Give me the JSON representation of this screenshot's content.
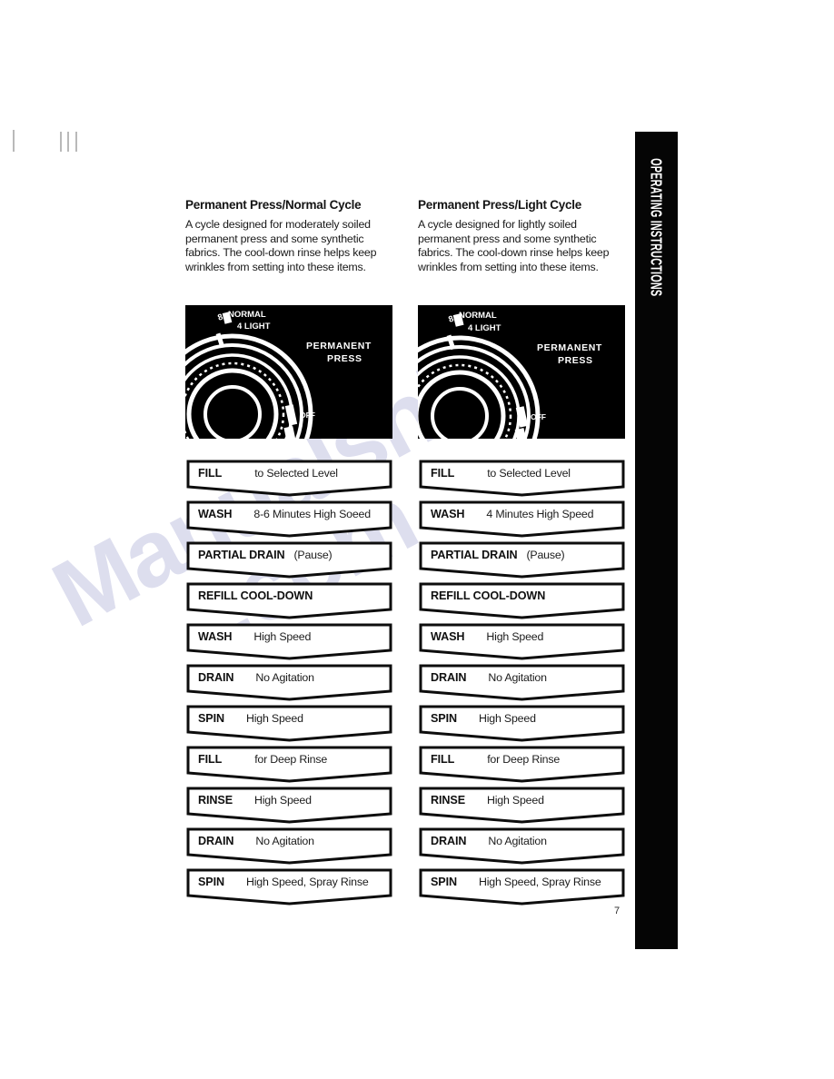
{
  "page": {
    "number": "7",
    "side_tab_label": "OPERATING INSTRUCTIONS",
    "watermark_line1": "Manualshive",
    "watermark_line2": ".com"
  },
  "columns": [
    {
      "id": "permanent-press-normal",
      "title": "Permanent Press/Normal Cycle",
      "description": "A cycle designed for moderately soiled permanent press and some synthetic fabrics. The cool-down rinse helps keep wrinkles from setting into these items.",
      "dial": {
        "label_top_number": "8",
        "label_top": "NORMAL",
        "label_bottom_number": "4",
        "label_bottom": "LIGHT",
        "cycle_name_line1": "PERMANENT",
        "cycle_name_line2": "PRESS",
        "off_label": "OFF"
      },
      "steps": [
        {
          "name": "FILL",
          "detail": "to Selected Level",
          "gap": "gap-wide"
        },
        {
          "name": "WASH",
          "detail": "8-6 Minutes High Soeed",
          "gap": "gap-mid"
        },
        {
          "name": "PARTIAL DRAIN",
          "detail": "(Pause)",
          "gap": "gap-small"
        },
        {
          "name": "REFILL COOL-DOWN",
          "detail": "",
          "gap": "gap-none"
        },
        {
          "name": "WASH",
          "detail": "High Speed",
          "gap": "gap-mid"
        },
        {
          "name": "DRAIN",
          "detail": "No Agitation",
          "gap": "gap-mid"
        },
        {
          "name": "SPIN",
          "detail": "High Speed",
          "gap": "gap-mid"
        },
        {
          "name": "FILL",
          "detail": "for Deep Rinse",
          "gap": "gap-wide"
        },
        {
          "name": "RINSE",
          "detail": "High Speed",
          "gap": "gap-mid"
        },
        {
          "name": "DRAIN",
          "detail": "No Agitation",
          "gap": "gap-mid"
        },
        {
          "name": "SPIN",
          "detail": "High Speed, Spray Rinse",
          "gap": "gap-mid"
        }
      ]
    },
    {
      "id": "permanent-press-light",
      "title": "Permanent Press/Light Cycle",
      "description": "A cycle designed for lightly soiled permanent press and some synthetic fabrics. The cool-down rinse helps keep wrinkles from setting into these items.",
      "dial": {
        "label_top_number": "8",
        "label_top": "NORMAL",
        "label_bottom_number": "4",
        "label_bottom": "LIGHT",
        "cycle_name_line1": "PERMANENT",
        "cycle_name_line2": "PRESS",
        "off_label": "OFF"
      },
      "steps": [
        {
          "name": "FILL",
          "detail": "to Selected Level",
          "gap": "gap-wide"
        },
        {
          "name": "WASH",
          "detail": "4 Minutes High Speed",
          "gap": "gap-mid"
        },
        {
          "name": "PARTIAL DRAIN",
          "detail": "(Pause)",
          "gap": "gap-small"
        },
        {
          "name": "REFILL COOL-DOWN",
          "detail": "",
          "gap": "gap-none"
        },
        {
          "name": "WASH",
          "detail": "High Speed",
          "gap": "gap-mid"
        },
        {
          "name": "DRAIN",
          "detail": "No Agitation",
          "gap": "gap-mid"
        },
        {
          "name": "SPIN",
          "detail": "High Speed",
          "gap": "gap-mid"
        },
        {
          "name": "FILL",
          "detail": "for Deep Rinse",
          "gap": "gap-wide"
        },
        {
          "name": "RINSE",
          "detail": "High Speed",
          "gap": "gap-mid"
        },
        {
          "name": "DRAIN",
          "detail": "No Agitation",
          "gap": "gap-mid"
        },
        {
          "name": "SPIN",
          "detail": "High Speed, Spray Rinse",
          "gap": "gap-mid"
        }
      ]
    }
  ],
  "colors": {
    "ink": "#111111",
    "tab_background": "#050505",
    "tab_text": "#ffffff",
    "watermark": "#3b3fa0",
    "paper": "#ffffff"
  }
}
